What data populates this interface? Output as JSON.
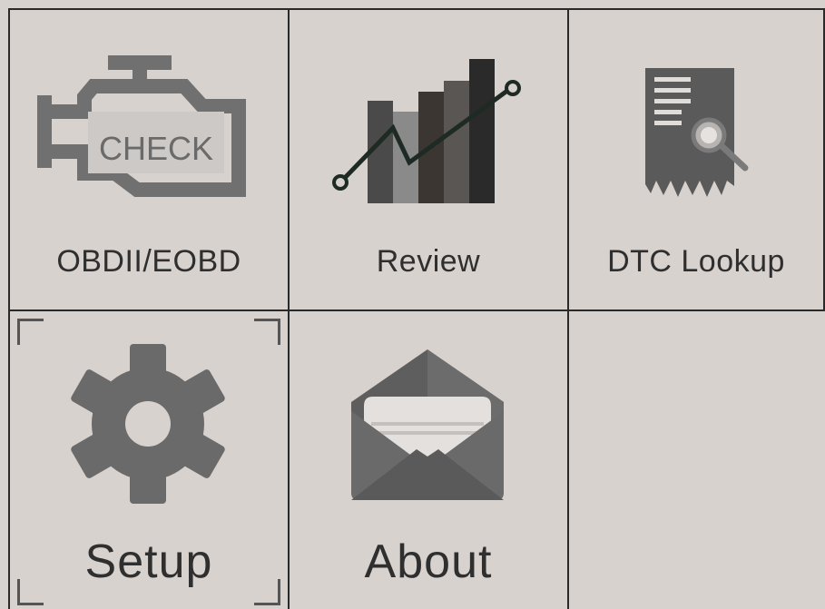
{
  "menu": {
    "items": [
      {
        "id": "obdii",
        "label": "OBDII/EOBD",
        "icon": "check-engine-icon",
        "icon_text": "CHECK"
      },
      {
        "id": "review",
        "label": "Review",
        "icon": "chart-icon"
      },
      {
        "id": "dtc",
        "label": "DTC Lookup",
        "icon": "document-search-icon"
      },
      {
        "id": "setup",
        "label": "Setup",
        "icon": "gear-icon",
        "selected": true
      },
      {
        "id": "about",
        "label": "About",
        "icon": "envelope-icon"
      }
    ]
  },
  "colors": {
    "background": "#d8d2cf",
    "grid_line": "#2a2a2a",
    "icon_gray": "#6e6e6e",
    "text": "#2f2f2f"
  }
}
